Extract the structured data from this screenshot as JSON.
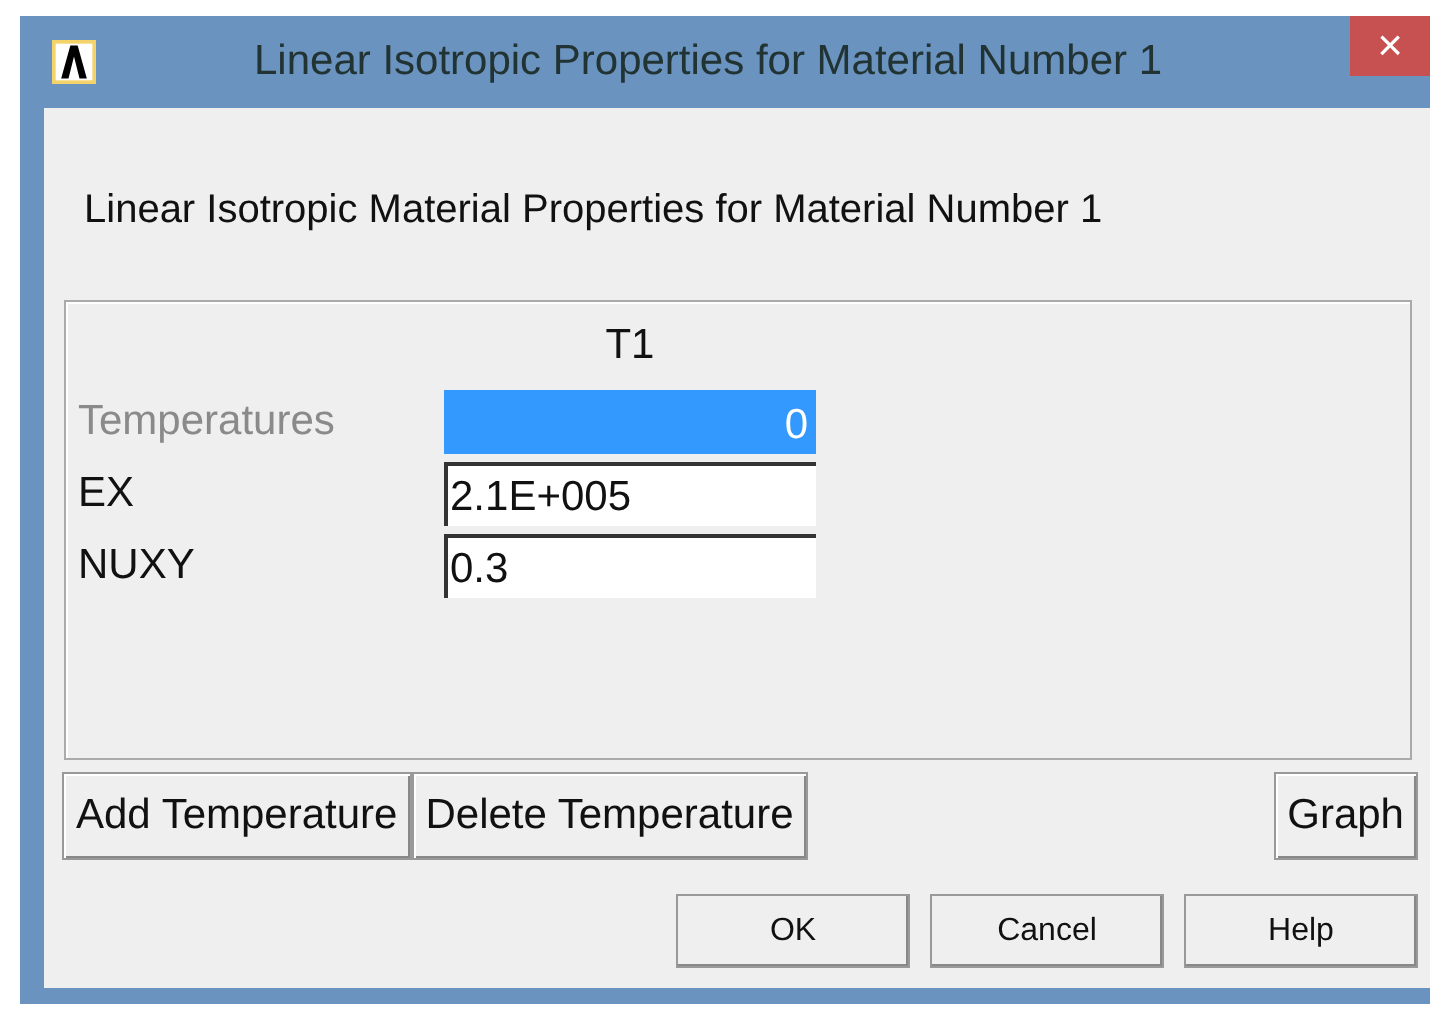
{
  "window": {
    "title": "Linear Isotropic Properties for Material Number 1",
    "close": "×"
  },
  "heading": "Linear Isotropic Material Properties for Material Number 1",
  "table": {
    "columns": [
      "T1"
    ],
    "rows": [
      {
        "kind": "temperature",
        "label": "Temperatures",
        "value": "0",
        "selected": true
      },
      {
        "kind": "property",
        "label": "EX",
        "value": "2.1E+005",
        "selected": false
      },
      {
        "kind": "property",
        "label": "NUXY",
        "value": "0.3",
        "selected": false
      }
    ]
  },
  "table_buttons": [
    "Add Temperature",
    "Delete Temperature"
  ],
  "graph_button": "Graph",
  "buttons": [
    "OK",
    "Cancel",
    "Help"
  ]
}
